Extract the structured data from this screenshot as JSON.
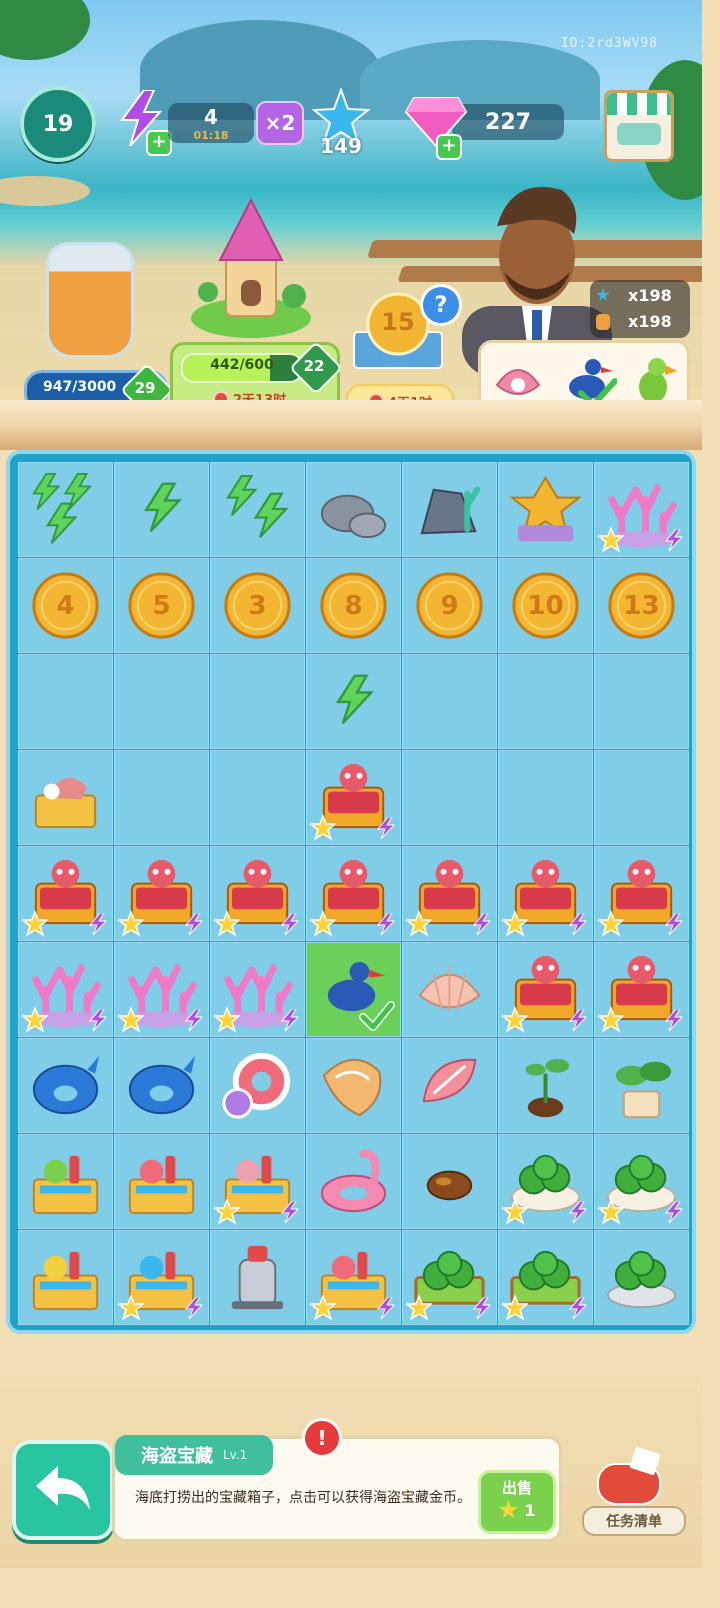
{
  "player_id": "ID:2rd3WV98",
  "level": "19",
  "energy": {
    "count": "4",
    "timer": "01:18",
    "multiplier": "×2"
  },
  "stars": "149",
  "gems": "227",
  "jar": {
    "progress_text": "947/3000",
    "badge": "29",
    "progress_fraction": 0.316
  },
  "tower": {
    "progress_text": "442/600",
    "badge": "22",
    "timer": "2天13时",
    "progress_fraction": 0.737
  },
  "coin_event": {
    "coin_value": "15",
    "hint": "?",
    "timer": "4天1时"
  },
  "rewards": {
    "star_count": "x198",
    "jar_count": "x198"
  },
  "board": {
    "rows": [
      [
        "energy-3",
        "energy-1",
        "energy-2",
        "rocks",
        "rock-coral",
        "shell-chest",
        "coral-chest"
      ],
      [
        "coin-4",
        "coin-5",
        "coin-3",
        "coin-8",
        "coin-9",
        "coin-10",
        "coin-13"
      ],
      [
        "",
        "",
        "",
        "energy-1",
        "",
        "",
        ""
      ],
      [
        "fish-crate",
        "",
        "",
        "pirate-chest",
        "",
        "",
        ""
      ],
      [
        "pirate-chest",
        "pirate-chest",
        "pirate-chest",
        "pirate-chest",
        "pirate-chest",
        "pirate-chest",
        "pirate-chest"
      ],
      [
        "coral",
        "coral",
        "coral",
        "bird",
        "clam-shell",
        "pirate-chest",
        "pirate-chest"
      ],
      [
        "whale-float",
        "whale-float",
        "swim-ring",
        "conch-shell",
        "spiral-shell",
        "sprout",
        "potted-plant"
      ],
      [
        "surf-basket-1",
        "surf-basket-2",
        "surf-basket-3",
        "flamingo-float",
        "seed",
        "watermelon-bowl",
        "watermelon-bowl"
      ],
      [
        "surf-basket-4",
        "surf-basket-5",
        "juicer",
        "surf-basket-6",
        "watermelon-crate",
        "watermelon-crate",
        "watermelon-plate"
      ]
    ],
    "coin_labels": [
      "4",
      "5",
      "3",
      "8",
      "9",
      "10",
      "13"
    ]
  },
  "info_panel": {
    "title": "海盗宝藏",
    "level": "Lv.1",
    "description": "海底打捞出的宝藏箱子，点击可以获得海盗宝藏金币。",
    "alert": "!",
    "sell_label": "出售",
    "sell_price": "1"
  },
  "task_button": "任务清单",
  "colors": {
    "accent": "#28c5a0",
    "board": "#1ea4c8",
    "cell": "#7fcde6"
  }
}
